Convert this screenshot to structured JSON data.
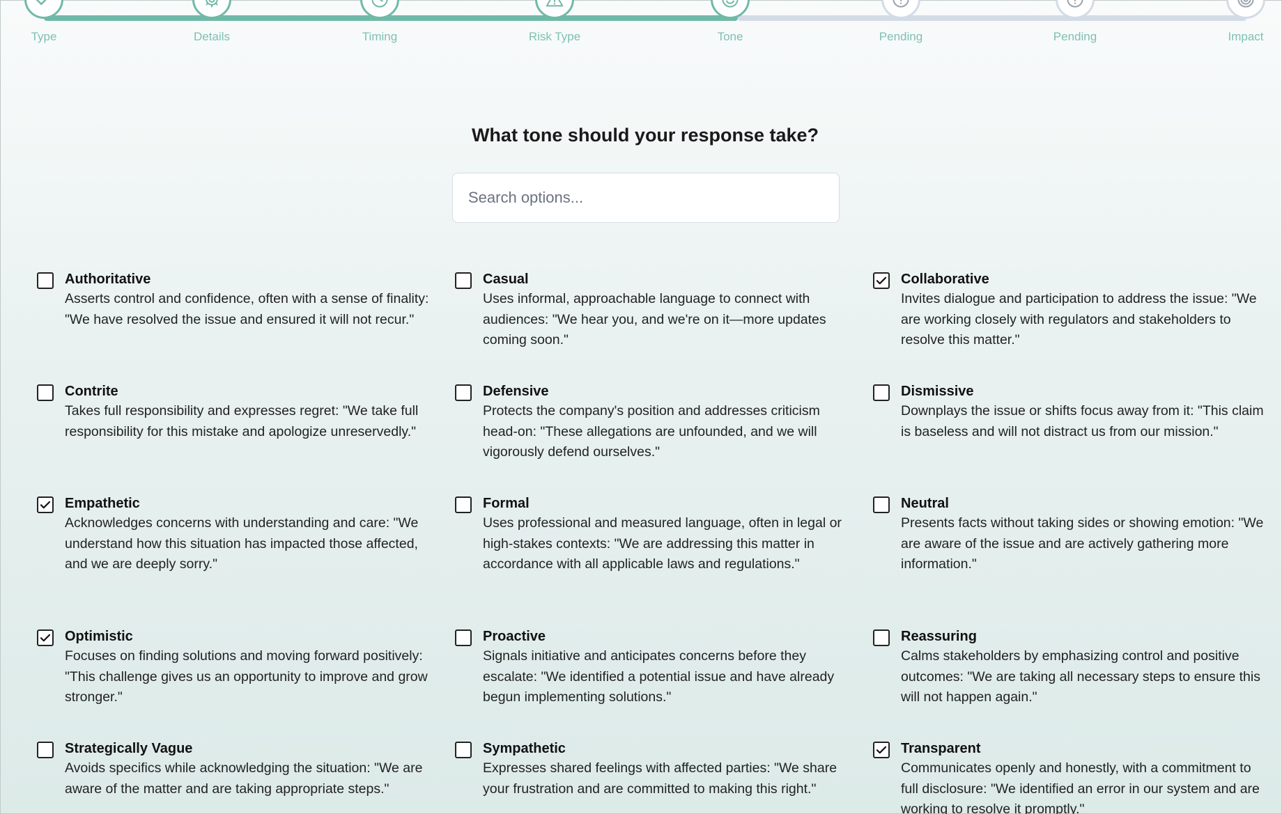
{
  "stepper": {
    "steps": [
      {
        "label": "Type",
        "icon": "check-icon",
        "state": "done"
      },
      {
        "label": "Details",
        "icon": "gear-icon",
        "state": "done"
      },
      {
        "label": "Timing",
        "icon": "clock-icon",
        "state": "done"
      },
      {
        "label": "Risk Type",
        "icon": "warning-icon",
        "state": "done"
      },
      {
        "label": "Tone",
        "icon": "smiley-icon",
        "state": "current"
      },
      {
        "label": "Pending",
        "icon": "question-icon",
        "state": "todo"
      },
      {
        "label": "Pending",
        "icon": "question-icon",
        "state": "todo"
      },
      {
        "label": "Impact",
        "icon": "target-icon",
        "state": "todo"
      }
    ],
    "colors": {
      "done": "#6fb9a7",
      "todo": "#d3dbe5"
    }
  },
  "title": "What tone should your response take?",
  "search": {
    "placeholder": "Search options...",
    "value": ""
  },
  "options": [
    {
      "label": "Authoritative",
      "checked": false,
      "desc": "Asserts control and confidence, often with a sense of finality: \"We have resolved the issue and ensured it will not recur.\""
    },
    {
      "label": "Casual",
      "checked": false,
      "desc": "Uses informal, approachable language to connect with audiences: \"We hear you, and we're on it—more updates coming soon.\""
    },
    {
      "label": "Collaborative",
      "checked": true,
      "desc": "Invites dialogue and participation to address the issue: \"We are working closely with regulators and stakeholders to resolve this matter.\""
    },
    {
      "label": "Contrite",
      "checked": false,
      "desc": "Takes full responsibility and expresses regret: \"We take full responsibility for this mistake and apologize unreservedly.\""
    },
    {
      "label": "Defensive",
      "checked": false,
      "desc": "Protects the company's position and addresses criticism head-on: \"These allegations are unfounded, and we will vigorously defend ourselves.\""
    },
    {
      "label": "Dismissive",
      "checked": false,
      "desc": "Downplays the issue or shifts focus away from it: \"This claim is baseless and will not distract us from our mission.\""
    },
    {
      "label": "Empathetic",
      "checked": true,
      "desc": "Acknowledges concerns with understanding and care: \"We understand how this situation has impacted those affected, and we are deeply sorry.\""
    },
    {
      "label": "Formal",
      "checked": false,
      "desc": "Uses professional and measured language, often in legal or high-stakes contexts: \"We are addressing this matter in accordance with all applicable laws and regulations.\""
    },
    {
      "label": "Neutral",
      "checked": false,
      "desc": "Presents facts without taking sides or showing emotion: \"We are aware of the issue and are actively gathering more information.\""
    },
    {
      "label": "Optimistic",
      "checked": true,
      "desc": "Focuses on finding solutions and moving forward positively: \"This challenge gives us an opportunity to improve and grow stronger.\""
    },
    {
      "label": "Proactive",
      "checked": false,
      "desc": "Signals initiative and anticipates concerns before they escalate: \"We identified a potential issue and have already begun implementing solutions.\""
    },
    {
      "label": "Reassuring",
      "checked": false,
      "desc": "Calms stakeholders by emphasizing control and positive outcomes: \"We are taking all necessary steps to ensure this will not happen again.\""
    },
    {
      "label": "Strategically Vague",
      "checked": false,
      "desc": "Avoids specifics while acknowledging the situation: \"We are aware of the matter and are taking appropriate steps.\""
    },
    {
      "label": "Sympathetic",
      "checked": false,
      "desc": "Expresses shared feelings with affected parties: \"We share your frustration and are committed to making this right.\""
    },
    {
      "label": "Transparent",
      "checked": true,
      "desc": "Communicates openly and honestly, with a commitment to full disclosure: \"We identified an error in our system and are working to resolve it promptly.\""
    }
  ]
}
